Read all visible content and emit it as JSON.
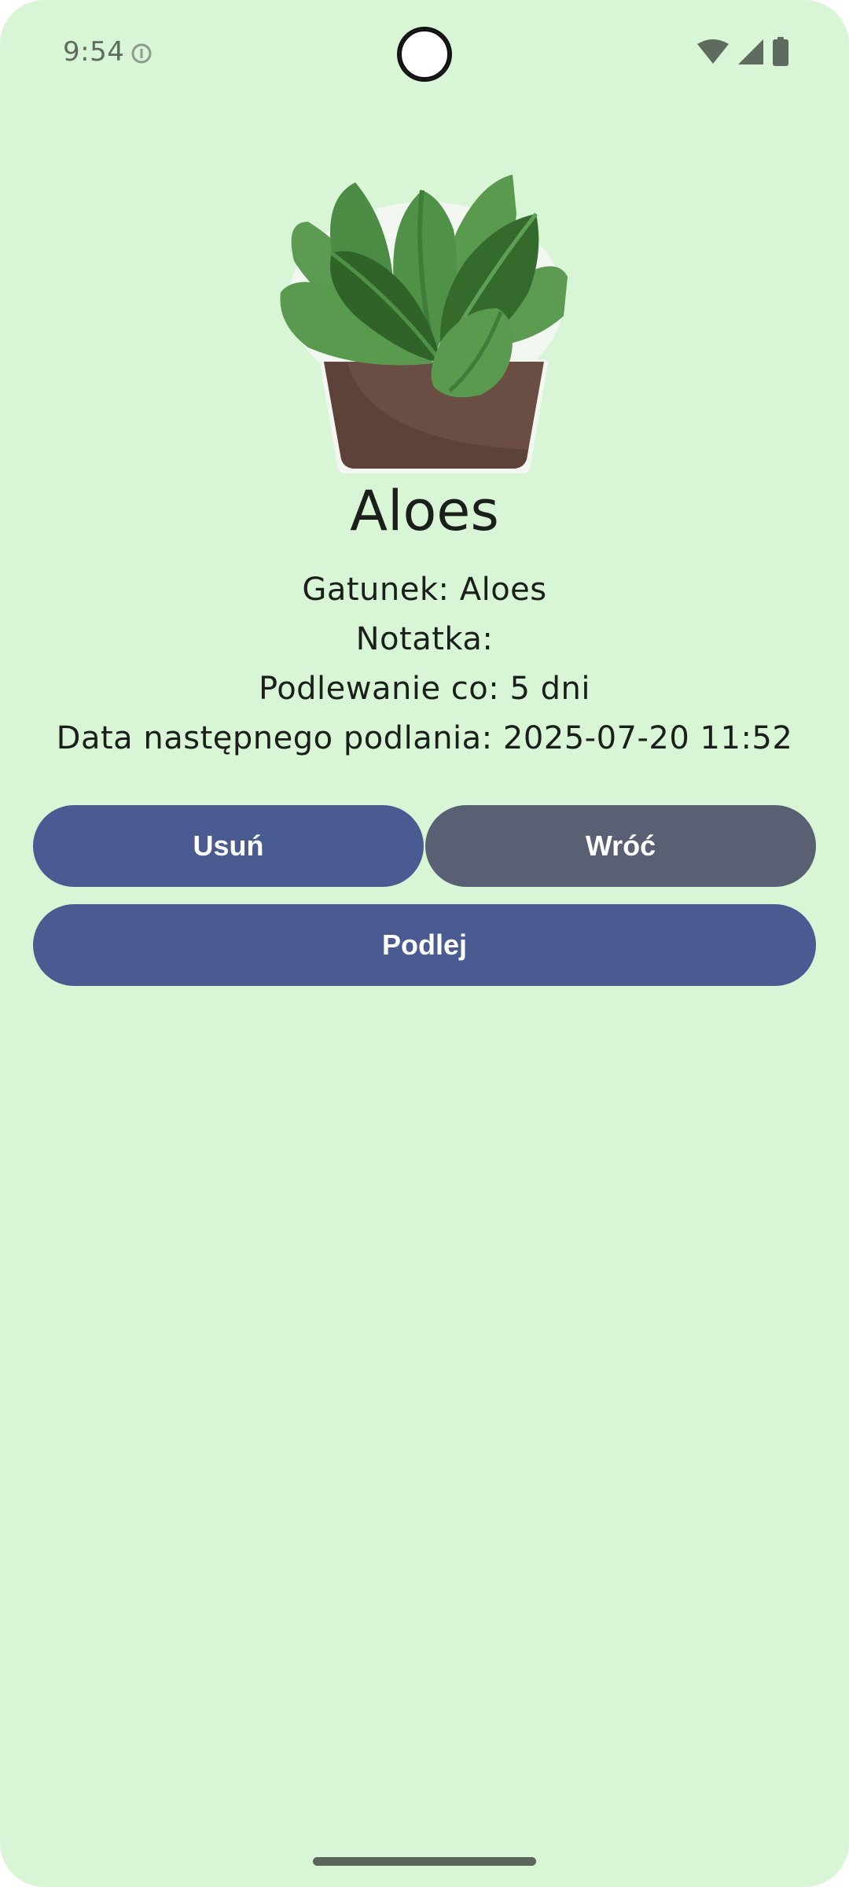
{
  "status_bar": {
    "time": "9:54",
    "icons": [
      "info-icon",
      "wifi-icon",
      "signal-icon",
      "battery-icon"
    ],
    "icon_color": "#5f6b5f"
  },
  "plant": {
    "image": "potted-succulent-illustration",
    "name": "Aloes",
    "species_line": "Gatunek: Aloes",
    "note_line": "Notatka:",
    "watering_line": "Podlewanie co: 5 dni",
    "next_watering_line": "Data następnego podlania: 2025-07-20 11:52"
  },
  "actions": {
    "delete_label": "Usuń",
    "back_label": "Wróć",
    "water_label": "Podlej"
  },
  "colors": {
    "background": "#d8f5d6",
    "primary_button": "#4a5b91",
    "secondary_button": "#5a6073",
    "text": "#1b1f1b"
  }
}
